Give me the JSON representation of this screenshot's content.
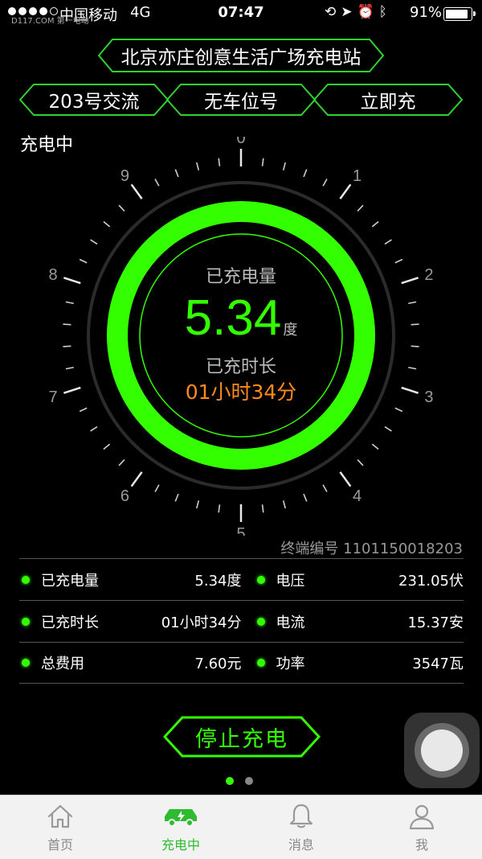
{
  "status_bar": {
    "carrier": "中国移动",
    "network": "4G",
    "time": "07:47",
    "battery_percent": "91%",
    "battery_level": 0.91,
    "watermark": "D117.COM 第一电动"
  },
  "header": {
    "station_name": "北京亦庄创意生活广场充电站",
    "tabs": [
      {
        "label": "203号交流"
      },
      {
        "label": "无车位号"
      },
      {
        "label": "立即充"
      }
    ]
  },
  "charging": {
    "status": "充电中",
    "energy_caption": "已充电量",
    "energy_value": "5.34",
    "energy_unit": "度",
    "time_caption": "已充时长",
    "time_value": "01小时34分",
    "dial_labels": [
      "0",
      "1",
      "2",
      "3",
      "4",
      "5",
      "6",
      "7",
      "8",
      "9"
    ]
  },
  "terminal": "终端编号 1101150018203",
  "details": [
    {
      "left_label": "已充电量",
      "left_value": "5.34度",
      "right_label": "电压",
      "right_value": "231.05伏"
    },
    {
      "left_label": "已充时长",
      "left_value": "01小时34分",
      "right_label": "电流",
      "right_value": "15.37安"
    },
    {
      "left_label": "总费用",
      "left_value": "7.60元",
      "right_label": "功率",
      "right_value": "3547瓦"
    }
  ],
  "stop_button": "停止充电",
  "pager": {
    "pages": 2,
    "current": 1
  },
  "tabbar": [
    {
      "label": "首页",
      "icon": "home-icon"
    },
    {
      "label": "充电中",
      "icon": "ev-car-icon"
    },
    {
      "label": "消息",
      "icon": "bell-icon"
    },
    {
      "label": "我",
      "icon": "person-icon"
    }
  ],
  "colors": {
    "accent_green": "#33ff00",
    "orange": "#ff8a1c",
    "tab_active": "#2fbb2f"
  }
}
